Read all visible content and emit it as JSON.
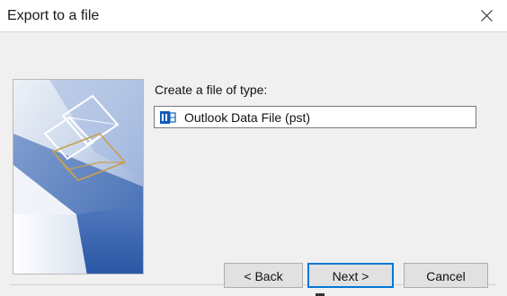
{
  "window": {
    "title": "Export to a file"
  },
  "icons": {
    "close": "close-icon",
    "pst_file": "outlook-data-file-icon"
  },
  "main": {
    "prompt": "Create a file of type:",
    "file_types": [
      {
        "label": "Outlook Data File (pst)",
        "selected": true
      }
    ]
  },
  "buttons": {
    "back_label": "< Back",
    "next_label": "Next >",
    "cancel_label": "Cancel"
  },
  "colors": {
    "accent": "#0078d7",
    "outlook_blue": "#0f5cb8",
    "art_gold": "#c9a04e"
  }
}
